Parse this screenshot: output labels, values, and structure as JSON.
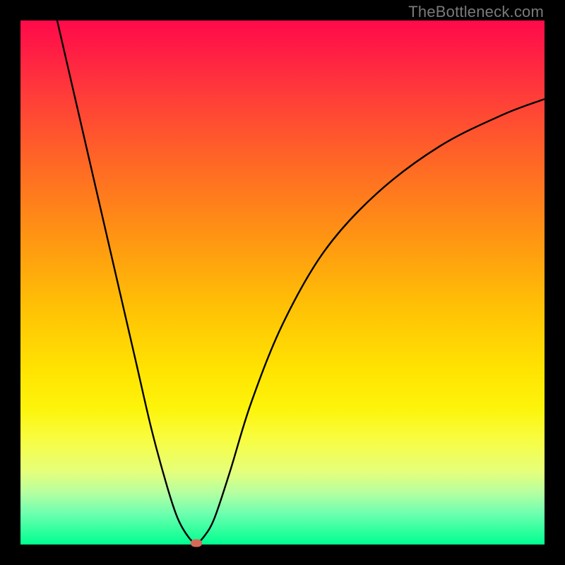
{
  "watermark": "TheBottleneck.com",
  "colors": {
    "frame_bg": "#000000",
    "grad_top": "#ff0a4a",
    "grad_bottom": "#00ff90",
    "curve_stroke": "#000000",
    "marker_fill": "#d56a5a",
    "watermark_color": "#7a7a7a"
  },
  "chart_data": {
    "type": "line",
    "title": "",
    "xlabel": "",
    "ylabel": "",
    "xlim": [
      0,
      100
    ],
    "ylim": [
      0,
      100
    ],
    "grid": false,
    "legend": false,
    "series": [
      {
        "name": "curve",
        "x": [
          7,
          10,
          13,
          16,
          19,
          22,
          25,
          28,
          30,
          32,
          33.5,
          35,
          37,
          40,
          44,
          50,
          58,
          68,
          80,
          92,
          100
        ],
        "values": [
          100,
          87,
          74,
          61,
          48,
          35,
          22,
          11,
          5,
          1.5,
          0.3,
          1.5,
          5,
          14,
          27,
          42,
          56,
          67,
          76,
          82,
          85
        ]
      }
    ],
    "marker": {
      "x": 33.5,
      "y": 0.3
    }
  }
}
